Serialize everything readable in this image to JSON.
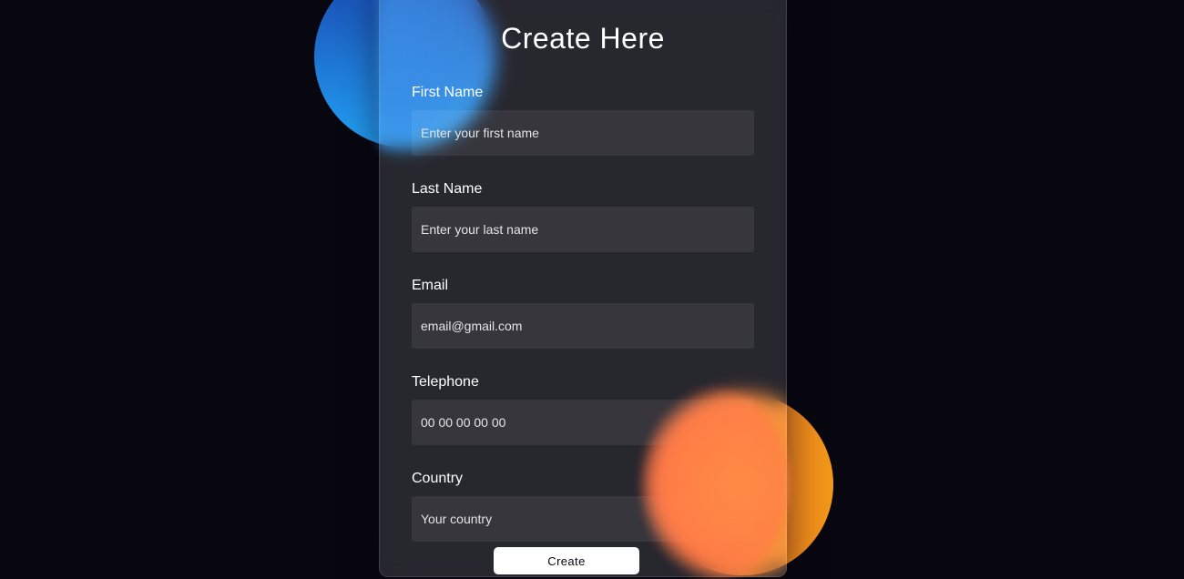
{
  "form": {
    "title": "Create Here",
    "fields": [
      {
        "label": "First Name",
        "placeholder": "Enter your first name"
      },
      {
        "label": "Last Name",
        "placeholder": "Enter your last name"
      },
      {
        "label": "Email",
        "placeholder": "email@gmail.com"
      },
      {
        "label": "Telephone",
        "placeholder": "00 00 00 00 00"
      },
      {
        "label": "Country",
        "placeholder": "Your country"
      }
    ],
    "submit_label": "Create"
  },
  "colors": {
    "background": "#080710",
    "blue_shape": [
      "#1845ad",
      "#23a2f6"
    ],
    "orange_shape": [
      "#ff512f",
      "#f09819"
    ]
  }
}
